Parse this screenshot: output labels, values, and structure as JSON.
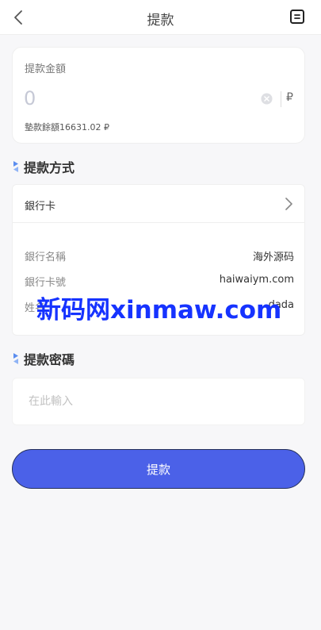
{
  "header": {
    "title": "提款",
    "back_icon": "chevron-left-icon",
    "record_icon": "document-icon"
  },
  "amount": {
    "label": "提款金額",
    "value": "0",
    "currency": "₽",
    "balance_text": "墊款餘額16631.02 ₽"
  },
  "method": {
    "section_title": "提款方式",
    "selected": "銀行卡",
    "rows": [
      {
        "label": "銀行名稱",
        "value": "海外源码"
      },
      {
        "label": "銀行卡號",
        "value": "haiwaiym.com"
      },
      {
        "label": "姓名",
        "value": "dada"
      }
    ]
  },
  "password": {
    "section_title": "提款密碼",
    "placeholder": "在此輸入"
  },
  "submit_label": "提款",
  "watermark": "新码网xinmaw.com",
  "colors": {
    "accent": "#4b61e8",
    "watermark": "#1633ff",
    "section_mark": "#5b8def"
  }
}
